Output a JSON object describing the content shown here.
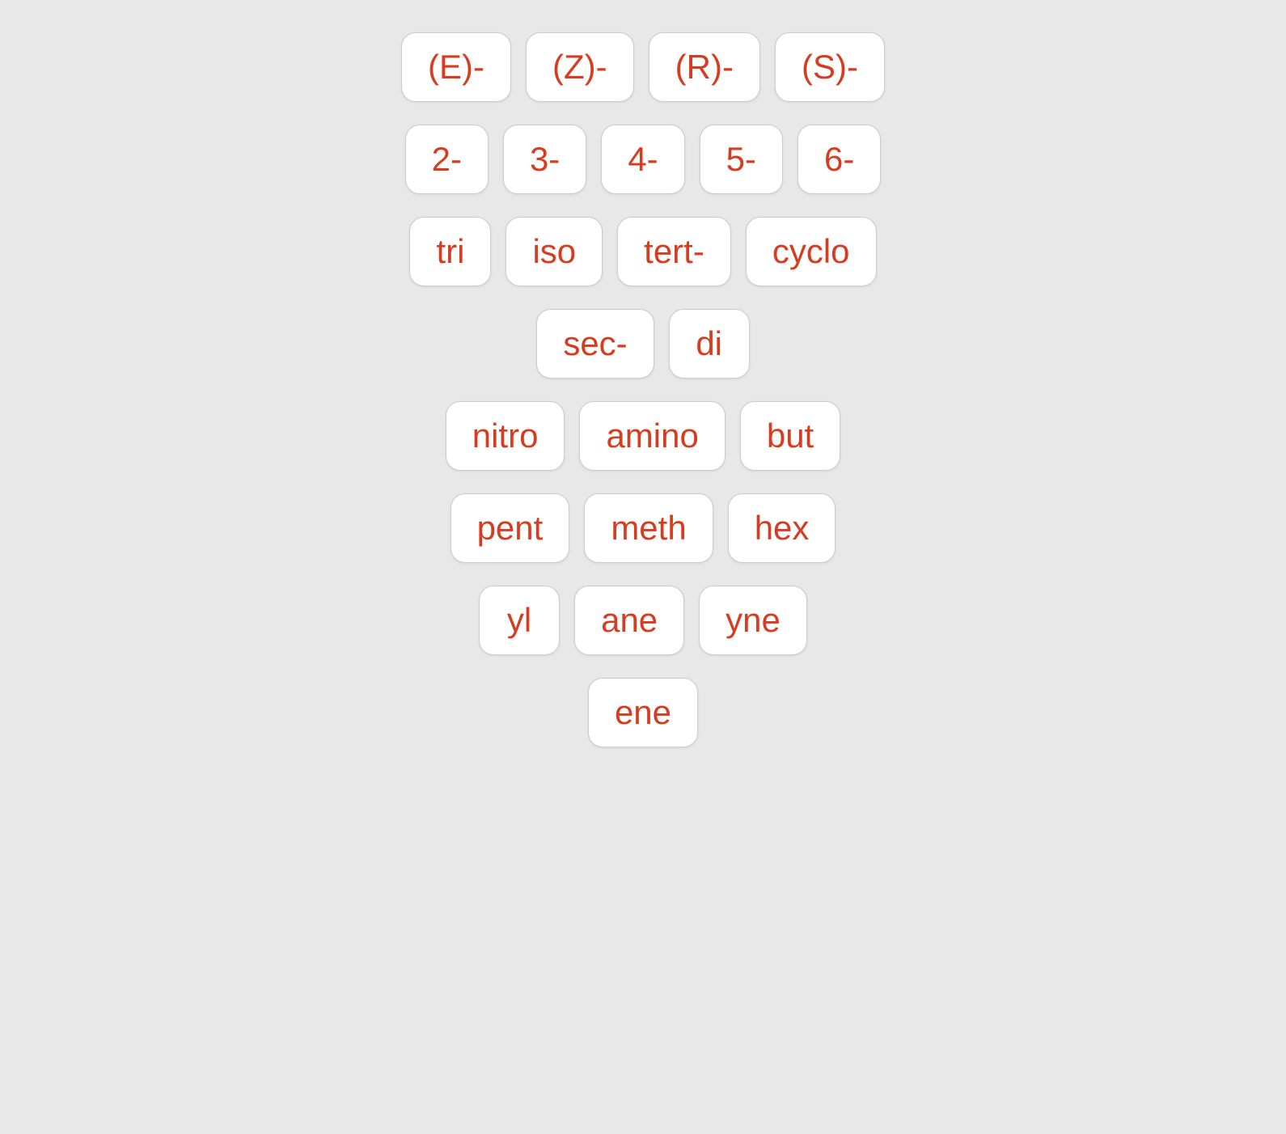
{
  "rows": [
    {
      "id": "row-ez",
      "buttons": [
        {
          "id": "btn-e",
          "label": "(E)-"
        },
        {
          "id": "btn-z",
          "label": "(Z)-"
        },
        {
          "id": "btn-r",
          "label": "(R)-"
        },
        {
          "id": "btn-s",
          "label": "(S)-"
        }
      ]
    },
    {
      "id": "row-numbers",
      "buttons": [
        {
          "id": "btn-2",
          "label": "2-"
        },
        {
          "id": "btn-3",
          "label": "3-"
        },
        {
          "id": "btn-4",
          "label": "4-"
        },
        {
          "id": "btn-5",
          "label": "5-"
        },
        {
          "id": "btn-6",
          "label": "6-"
        }
      ]
    },
    {
      "id": "row-prefixes1",
      "buttons": [
        {
          "id": "btn-tri",
          "label": "tri"
        },
        {
          "id": "btn-iso",
          "label": "iso"
        },
        {
          "id": "btn-tert",
          "label": "tert-"
        },
        {
          "id": "btn-cyclo",
          "label": "cyclo"
        }
      ]
    },
    {
      "id": "row-prefixes2",
      "buttons": [
        {
          "id": "btn-sec",
          "label": "sec-"
        },
        {
          "id": "btn-di",
          "label": "di"
        }
      ]
    },
    {
      "id": "row-roots1",
      "buttons": [
        {
          "id": "btn-nitro",
          "label": "nitro"
        },
        {
          "id": "btn-amino",
          "label": "amino"
        },
        {
          "id": "btn-but",
          "label": "but"
        }
      ]
    },
    {
      "id": "row-roots2",
      "buttons": [
        {
          "id": "btn-pent",
          "label": "pent"
        },
        {
          "id": "btn-meth",
          "label": "meth"
        },
        {
          "id": "btn-hex",
          "label": "hex"
        }
      ]
    },
    {
      "id": "row-suffixes1",
      "buttons": [
        {
          "id": "btn-yl",
          "label": "yl"
        },
        {
          "id": "btn-ane",
          "label": "ane"
        },
        {
          "id": "btn-yne",
          "label": "yne"
        }
      ]
    },
    {
      "id": "row-suffixes2",
      "buttons": [
        {
          "id": "btn-ene",
          "label": "ene"
        }
      ]
    }
  ]
}
